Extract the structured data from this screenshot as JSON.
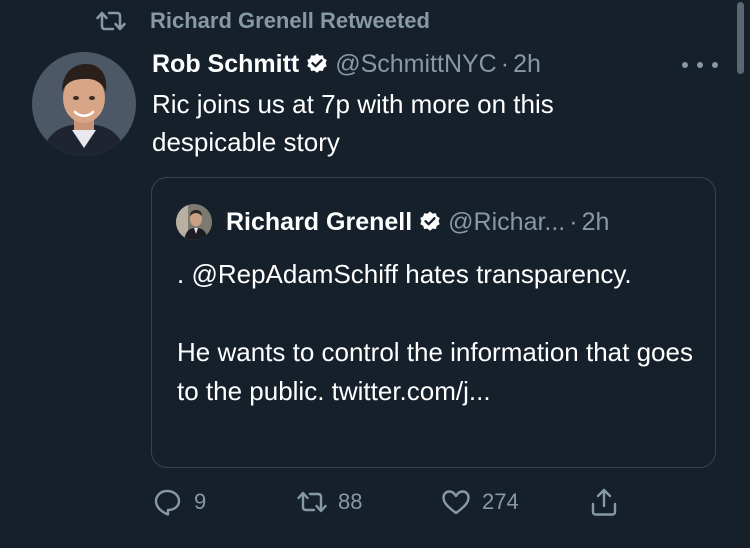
{
  "retweet_banner": {
    "text": "Richard Grenell Retweeted",
    "icon": "retweet-icon"
  },
  "tweet": {
    "display_name": "Rob Schmitt",
    "verified": true,
    "handle": "@SchmittNYC",
    "separator": "·",
    "time": "2h",
    "text": "Ric joins us at 7p with more on this despicable story"
  },
  "quote_tweet": {
    "display_name": "Richard Grenell",
    "verified": true,
    "handle": "@Richar...",
    "separator": "·",
    "time": "2h",
    "text": ". @RepAdamSchiff hates transparency.\n\nHe wants to control the information that goes to the public. twitter.com/j..."
  },
  "actions": {
    "reply_count": "9",
    "retweet_count": "88",
    "like_count": "274"
  },
  "colors": {
    "background": "#15202b",
    "muted": "#8899a6",
    "border": "#38444d",
    "text": "#ffffff",
    "verified_badge": "#ffffff"
  }
}
